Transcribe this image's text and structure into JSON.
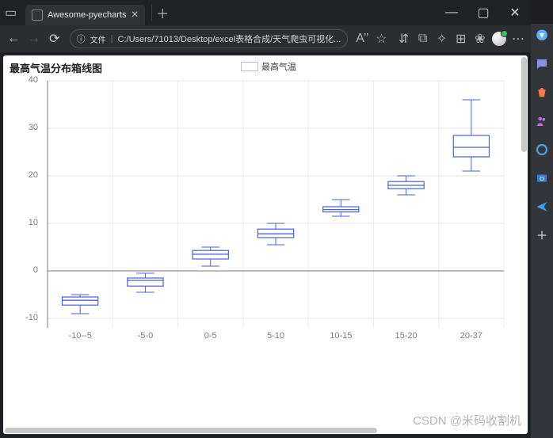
{
  "browser": {
    "tab_title": "Awesome-pyecharts",
    "url_badge_label": "文件",
    "url_text": "C:/Users/71013/Desktop/excel表格合成/天气爬虫可视化...",
    "reader_badge": "A’’"
  },
  "page": {
    "title": "最高气温分布箱线图",
    "legend_label": "最高气温"
  },
  "watermark": "CSDN @米码收割机",
  "chart_data": {
    "type": "boxplot",
    "xlabel": "",
    "ylabel": "",
    "ylim": [
      -12,
      40
    ],
    "categories": [
      "-10--5",
      "-5-0",
      "0-5",
      "5-10",
      "10-15",
      "15-20",
      "20-37"
    ],
    "series": [
      {
        "name": "最高气温",
        "boxes": [
          {
            "min": -9,
            "q1": -7.2,
            "median": -6.2,
            "q3": -5.5,
            "max": -5
          },
          {
            "min": -4.5,
            "q1": -3.2,
            "median": -2,
            "q3": -1.5,
            "max": -0.5
          },
          {
            "min": 1.0,
            "q1": 2.5,
            "median": 3.5,
            "q3": 4.3,
            "max": 5.0
          },
          {
            "min": 5.5,
            "q1": 7.0,
            "median": 7.8,
            "q3": 8.8,
            "max": 10.0
          },
          {
            "min": 11.5,
            "q1": 12.4,
            "median": 12.9,
            "q3": 13.5,
            "max": 15.0
          },
          {
            "min": 16.0,
            "q1": 17.3,
            "median": 18.0,
            "q3": 18.8,
            "max": 20.0
          },
          {
            "min": 21.0,
            "q1": 24.0,
            "median": 26.0,
            "q3": 28.5,
            "max": 36.0
          }
        ]
      }
    ],
    "y_ticks": [
      -10,
      0,
      10,
      20,
      30,
      40
    ]
  }
}
